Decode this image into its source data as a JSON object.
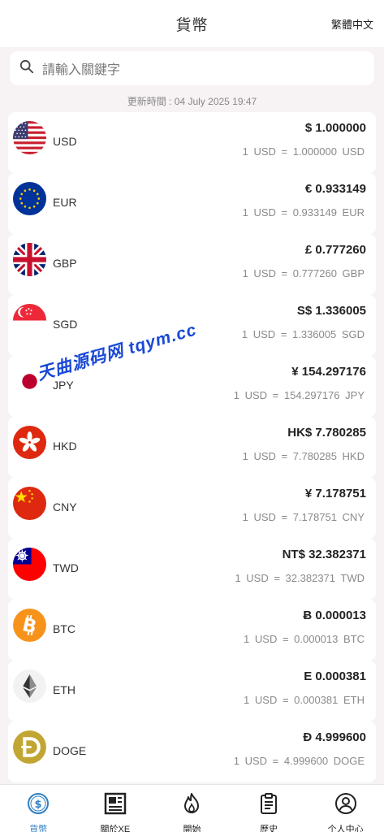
{
  "header": {
    "title": "貨幣",
    "lang": "繁體中文"
  },
  "search": {
    "placeholder": "請輸入關鍵字"
  },
  "updated": "更新時間 : 04 July 2025 19:47",
  "currencies": [
    {
      "code": "USD",
      "price": "$ 1.000000",
      "rate": "1 USD = 1.000000 USD",
      "flag": "us-flag-icon"
    },
    {
      "code": "EUR",
      "price": "€ 0.933149",
      "rate": "1 USD = 0.933149 EUR",
      "flag": "eu-flag-icon"
    },
    {
      "code": "GBP",
      "price": "£ 0.777260",
      "rate": "1 USD = 0.777260 GBP",
      "flag": "uk-flag-icon"
    },
    {
      "code": "SGD",
      "price": "S$ 1.336005",
      "rate": "1 USD = 1.336005 SGD",
      "flag": "sg-flag-icon"
    },
    {
      "code": "JPY",
      "price": "¥ 154.297176",
      "rate": "1 USD = 154.297176 JPY",
      "flag": "jp-flag-icon"
    },
    {
      "code": "HKD",
      "price": "HK$ 7.780285",
      "rate": "1 USD = 7.780285 HKD",
      "flag": "hk-flag-icon"
    },
    {
      "code": "CNY",
      "price": "¥ 7.178751",
      "rate": "1 USD = 7.178751 CNY",
      "flag": "cn-flag-icon"
    },
    {
      "code": "TWD",
      "price": "NT$ 32.382371",
      "rate": "1 USD = 32.382371 TWD",
      "flag": "tw-flag-icon"
    },
    {
      "code": "BTC",
      "price": "Ƀ 0.000013",
      "rate": "1 USD = 0.000013 BTC",
      "flag": "bitcoin-icon"
    },
    {
      "code": "ETH",
      "price": "Ε 0.000381",
      "rate": "1 USD = 0.000381 ETH",
      "flag": "ethereum-icon"
    },
    {
      "code": "DOGE",
      "price": "Ð 4.999600",
      "rate": "1 USD = 4.999600 DOGE",
      "flag": "dogecoin-icon"
    }
  ],
  "tabs": [
    {
      "label": "貨幣",
      "icon": "dollar-circle-icon",
      "active": true
    },
    {
      "label": "關於XE",
      "icon": "newspaper-icon",
      "active": false
    },
    {
      "label": "開始",
      "icon": "flame-icon",
      "active": false
    },
    {
      "label": "歷史",
      "icon": "clipboard-icon",
      "active": false
    },
    {
      "label": "个人中心",
      "icon": "user-circle-icon",
      "active": false
    }
  ],
  "watermark": "天曲源码网 tqym.cc",
  "colors": {
    "accent": "#2f7fc1",
    "background": "#f7f2f4",
    "watermark": "#1a49d6"
  }
}
